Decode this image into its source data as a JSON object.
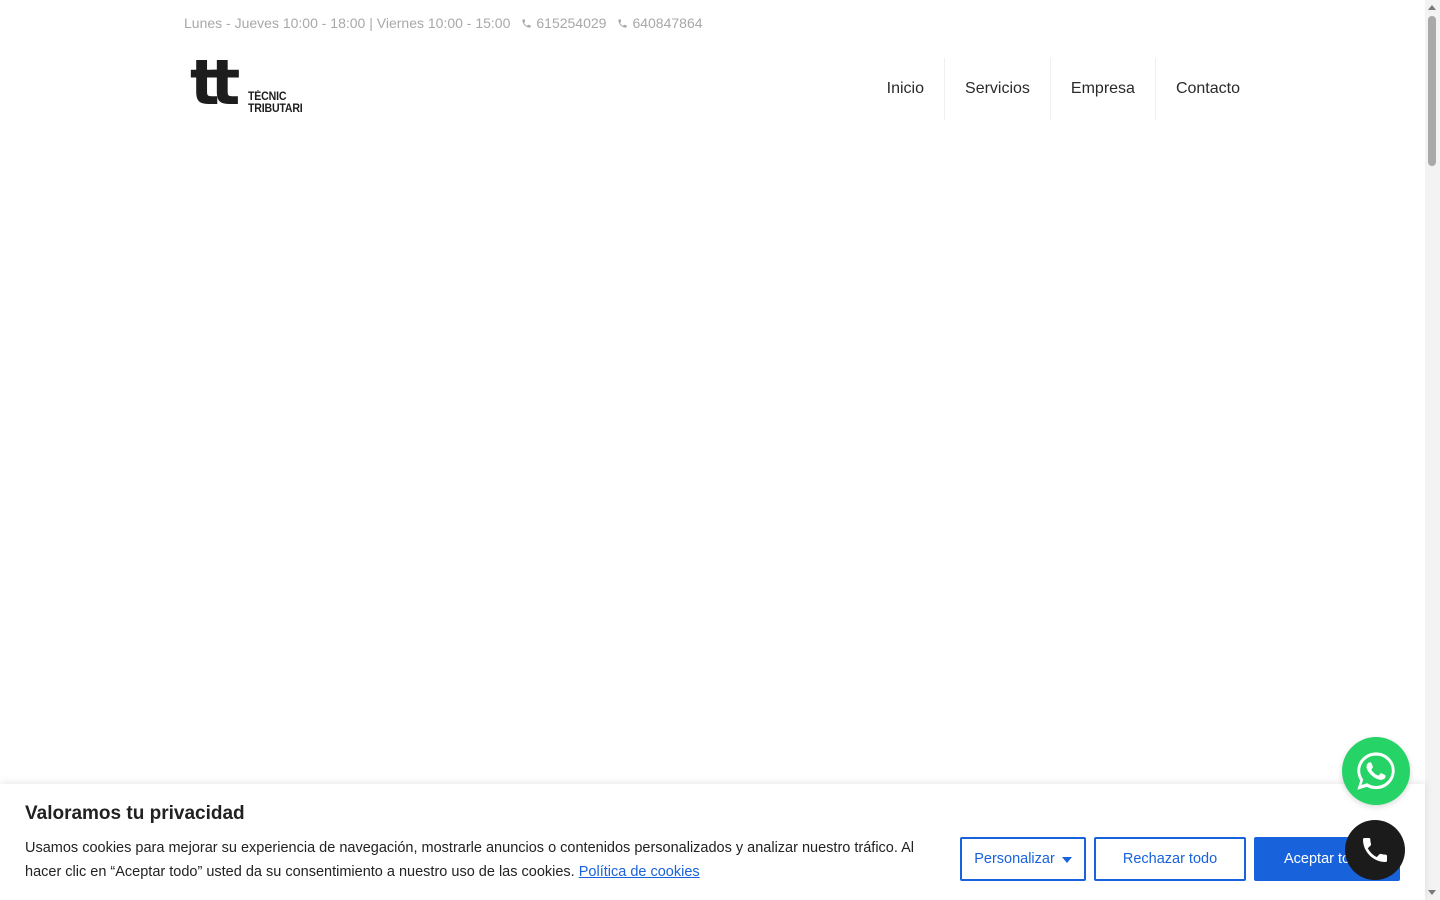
{
  "topbar": {
    "hours": "Lunes - Jueves 10:00 - 18:00 | Viernes 10:00 - 15:00",
    "phone1": "615254029",
    "phone2": "640847864"
  },
  "logo": {
    "mark": "tt",
    "line1": "TÈCNIC",
    "line2": "TRIBUTARI"
  },
  "nav": {
    "items": [
      "Inicio",
      "Servicios",
      "Empresa",
      "Contacto"
    ]
  },
  "cookie_banner": {
    "title": "Valoramos tu privacidad",
    "text": "Usamos cookies para mejorar su experiencia de navegación, mostrarle anuncios o contenidos personalizados y analizar nuestro tráfico. Al hacer clic en “Aceptar todo” usted da su consentimiento a nuestro uso de las cookies.",
    "policy_link": "Política de cookies",
    "customize_label": "Personalizar",
    "reject_label": "Rechazar todo",
    "accept_label": "Aceptar todo"
  },
  "floating": {
    "whatsapp_icon": "whatsapp-icon",
    "phone_icon": "phone-icon"
  },
  "colors": {
    "accent": "#1863dc",
    "whatsapp": "#25d366",
    "call_button": "#1b1b1b"
  }
}
